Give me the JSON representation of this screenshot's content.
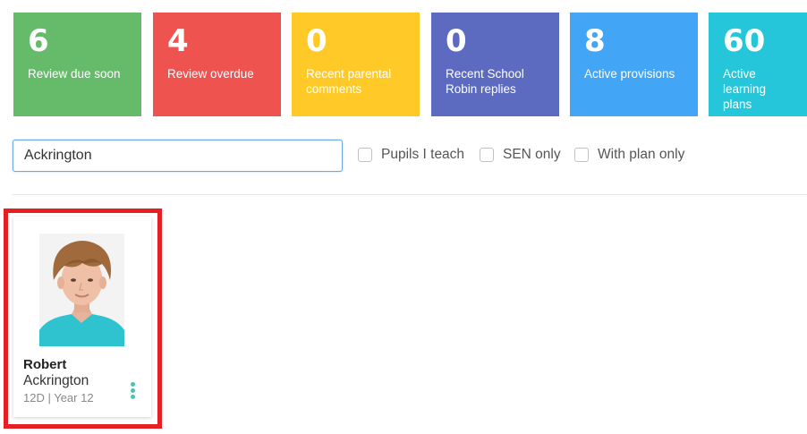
{
  "stats": [
    {
      "value": "6",
      "label": "Review due soon",
      "color": "#66bb6a"
    },
    {
      "value": "4",
      "label": "Review overdue",
      "color": "#ef5350"
    },
    {
      "value": "0",
      "label": "Recent parental\ncomments",
      "color": "#ffca28"
    },
    {
      "value": "0",
      "label": "Recent School\nRobin replies",
      "color": "#5c6bc0"
    },
    {
      "value": "8",
      "label": "Active provisions",
      "color": "#42a5f5"
    },
    {
      "value": "60",
      "label": "Active learning\nplans",
      "color": "#26c6da"
    }
  ],
  "search": {
    "value": "Ackrington"
  },
  "filters": [
    {
      "label": "Pupils I teach",
      "checked": false
    },
    {
      "label": "SEN only",
      "checked": false
    },
    {
      "label": "With plan only",
      "checked": false
    }
  ],
  "pupil": {
    "first_name": "Robert",
    "last_name": "Ackrington",
    "meta": "12D | Year 12",
    "photo": "pupil-photo",
    "menu_icon": "kebab-menu-icon",
    "accent": "#4cc1b0"
  },
  "highlight_color": "#e51f24"
}
